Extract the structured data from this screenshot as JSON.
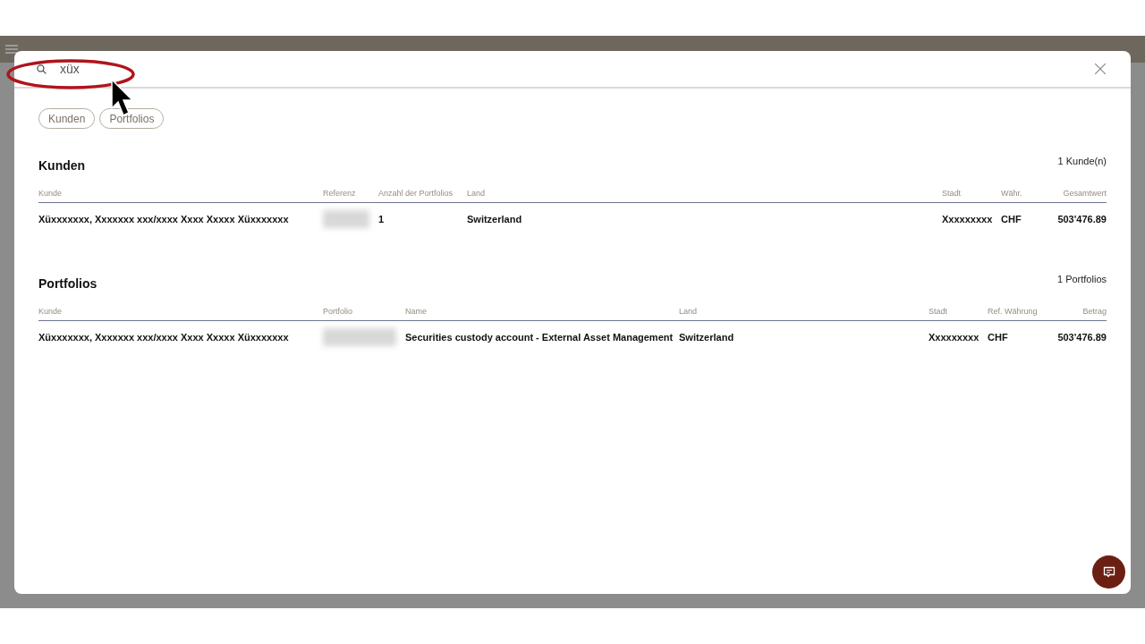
{
  "search": {
    "value": "xüx"
  },
  "filters": [
    {
      "label": "Kunden",
      "selected": false
    },
    {
      "label": "Portfolios",
      "selected": false
    }
  ],
  "sections": [
    {
      "title": "Kunden",
      "count": "1 Kunde(n)",
      "columns": [
        "Kunde",
        "Referenz",
        "Anzahl der Portfolios",
        "Land",
        "Stadt",
        "Währ.",
        "Gesamtwert"
      ],
      "rows": [
        [
          {
            "kind": "text",
            "text": "Xüxxxxxxx, Xxxxxxx xxx/xxxx Xxxx Xxxxx Xüxxxxxxx"
          },
          {
            "kind": "redacted"
          },
          {
            "kind": "text",
            "text": "1"
          },
          {
            "kind": "text",
            "text": "Switzerland"
          },
          {
            "kind": "text",
            "text": "Xxxxxxxxx"
          },
          {
            "kind": "text",
            "text": "CHF"
          },
          {
            "kind": "text",
            "text": "503'476.89"
          }
        ]
      ]
    },
    {
      "title": "Portfolios",
      "count": "1 Portfolios",
      "columns": [
        "Kunde",
        "Portfolio",
        "Name",
        "Land",
        "Stadt",
        "Ref. Währung",
        "Betrag"
      ],
      "rows": [
        [
          {
            "kind": "text",
            "text": "Xüxxxxxxx, Xxxxxxx xxx/xxxx Xxxx Xxxxx Xüxxxxxxx"
          },
          {
            "kind": "redacted"
          },
          {
            "kind": "text",
            "text": "Securities custody account - External Asset Management"
          },
          {
            "kind": "text",
            "text": "Switzerland"
          },
          {
            "kind": "text",
            "text": "Xxxxxxxxx"
          },
          {
            "kind": "text",
            "text": "CHF"
          },
          {
            "kind": "text",
            "text": "503'476.89"
          }
        ]
      ]
    }
  ]
}
